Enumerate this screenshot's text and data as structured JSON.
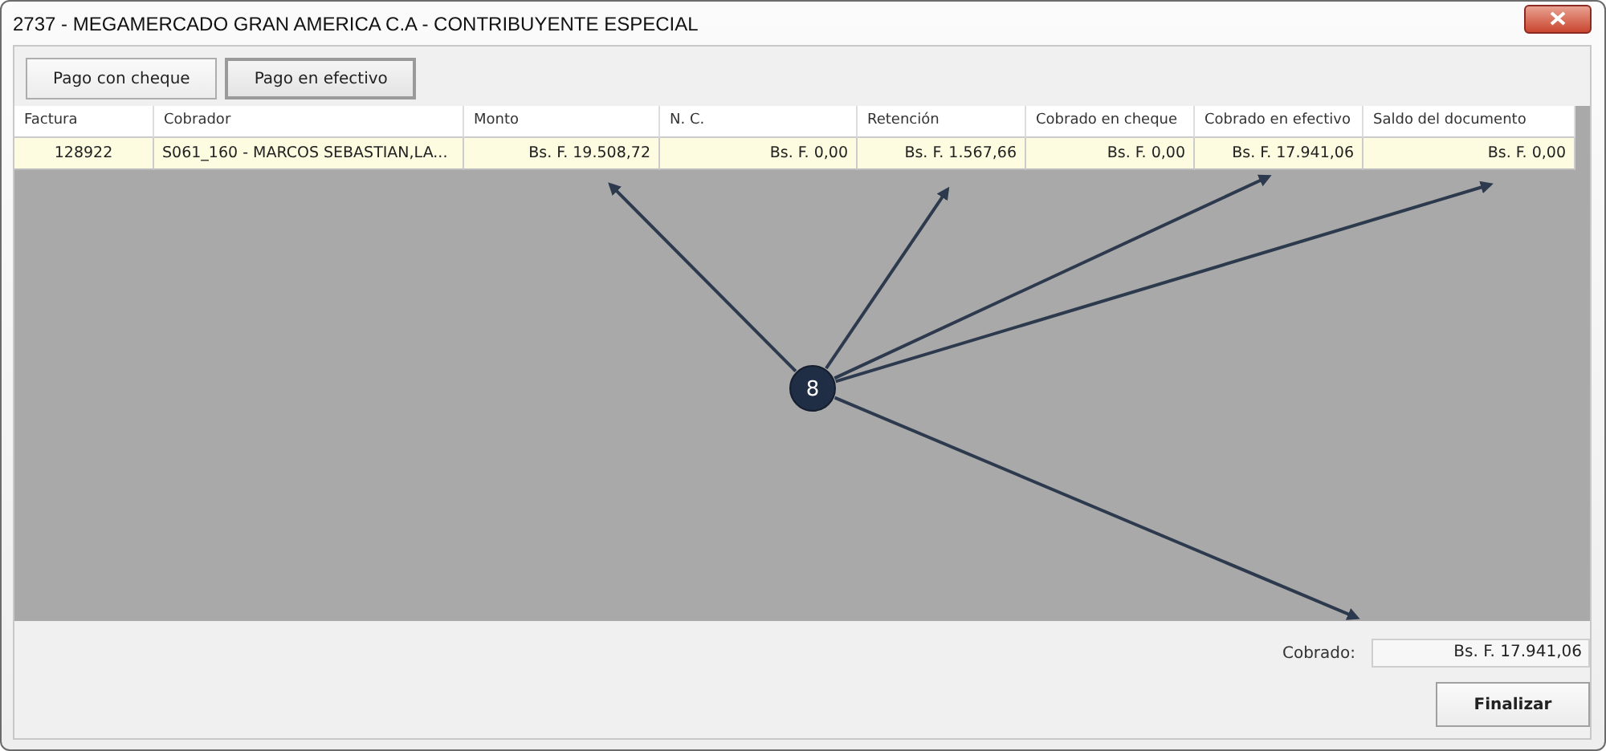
{
  "window": {
    "title": "2737 - MEGAMERCADO GRAN AMERICA C.A - CONTRIBUYENTE ESPECIAL"
  },
  "toolbar": [
    {
      "label": "Pago con cheque",
      "selected": false
    },
    {
      "label": "Pago en efectivo",
      "selected": true
    }
  ],
  "table": {
    "columns": [
      "Factura",
      "Cobrador",
      "Monto",
      "N. C.",
      "Retención",
      "Cobrado en cheque",
      "Cobrado en efectivo",
      "Saldo del documento"
    ],
    "rows": [
      {
        "selected": true,
        "cells": [
          "128922",
          "S061_160 - MARCOS SEBASTIAN,LA...",
          "Bs. F. 19.508,72",
          "Bs. F. 0,00",
          "Bs. F. 1.567,66",
          "Bs. F. 0,00",
          "Bs. F. 17.941,06",
          "Bs. F. 0,00"
        ]
      }
    ]
  },
  "callout": {
    "label": "8"
  },
  "summary": {
    "label": "Cobrado:",
    "value": "Bs. F. 17.941,06"
  },
  "buttons": [
    "Finalizar"
  ]
}
